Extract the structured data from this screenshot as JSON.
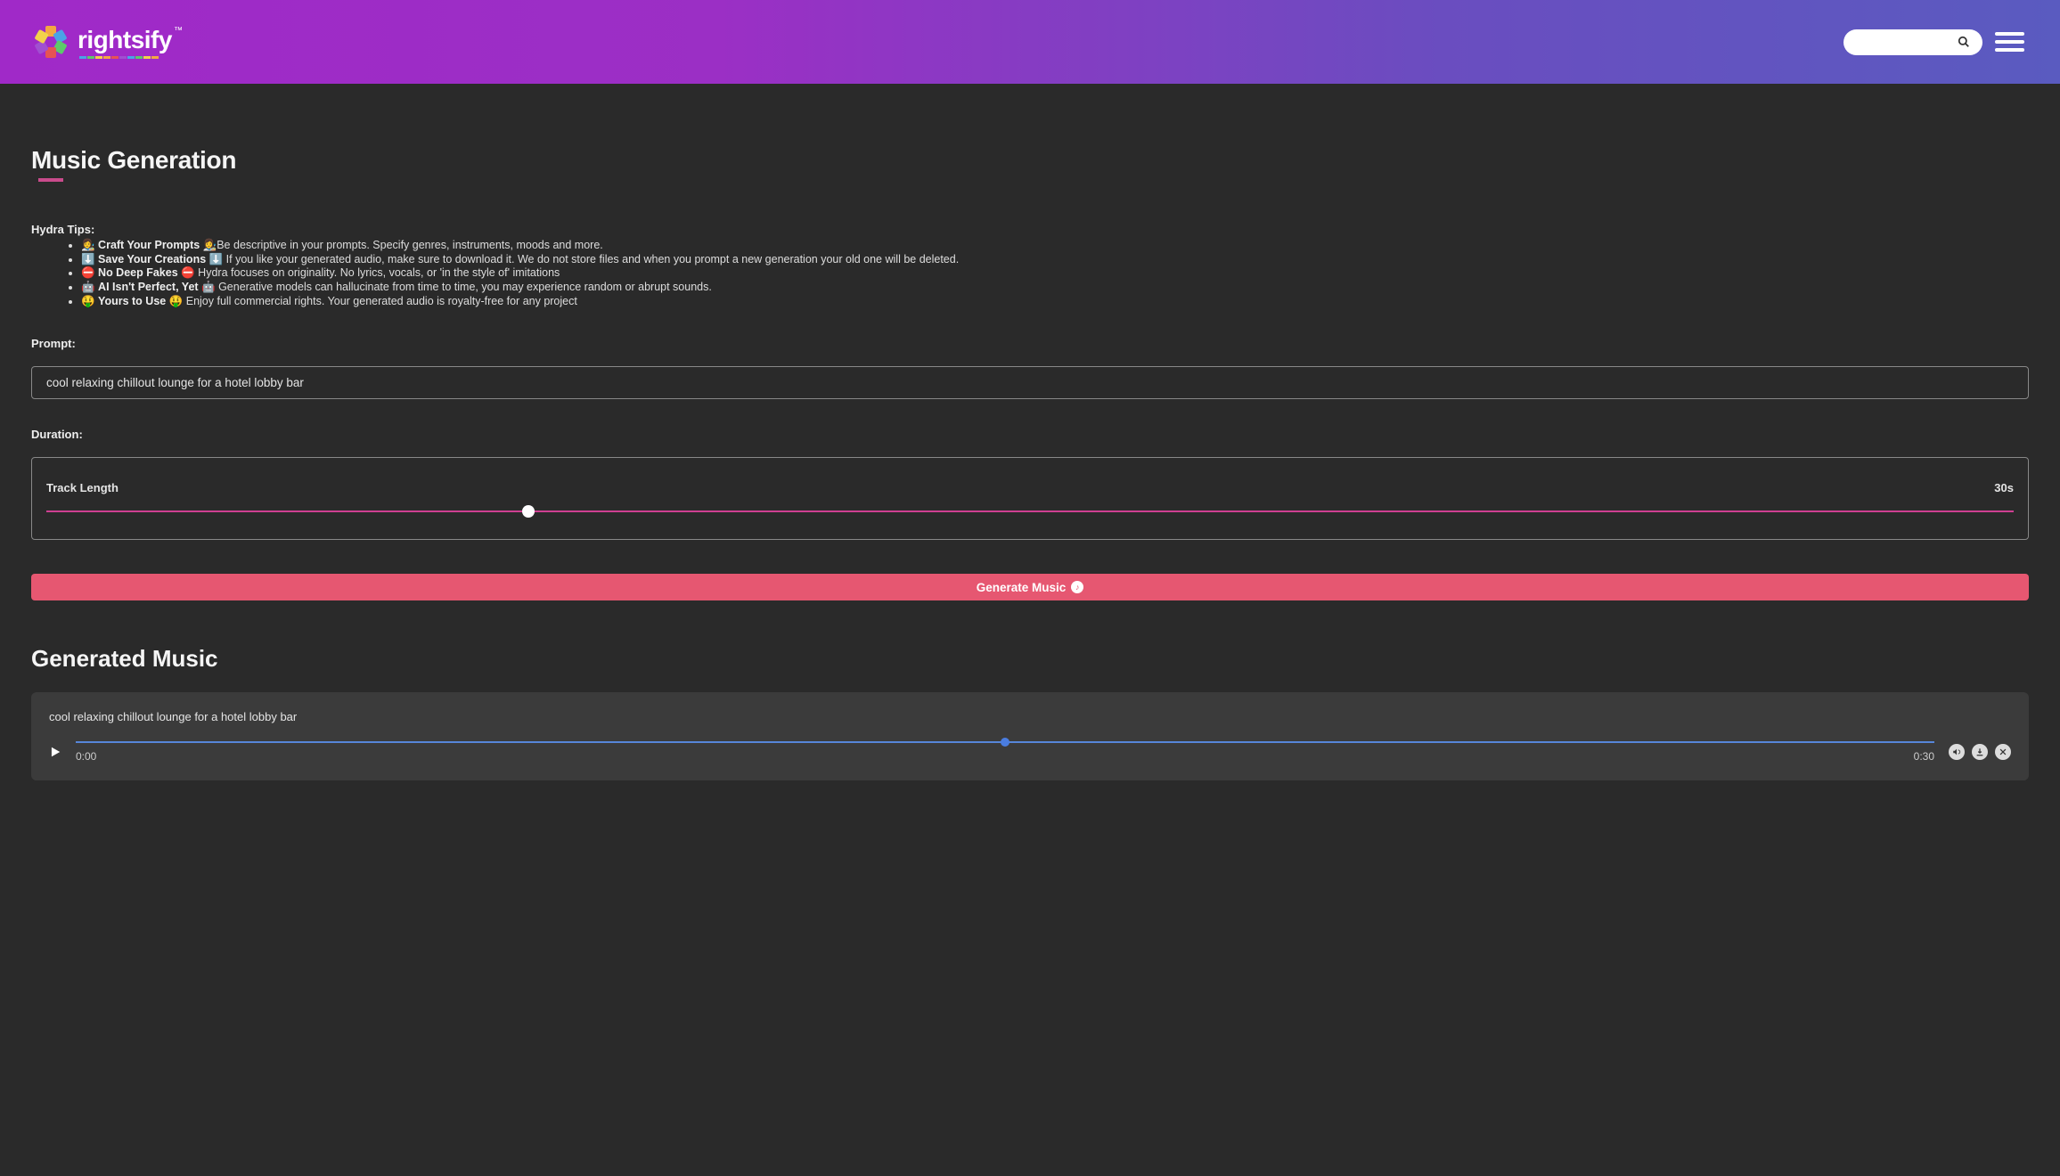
{
  "header": {
    "brand": "rightsify",
    "tm": "™"
  },
  "page": {
    "title": "Music Generation"
  },
  "tips": {
    "heading": "Hydra Tips:",
    "items": [
      {
        "prefix": "👩‍🎨 ",
        "bold": "Craft Your Prompts",
        "rest": " 👩‍🎨Be descriptive in your prompts. Specify genres, instruments, moods and more."
      },
      {
        "prefix": "⬇️ ",
        "bold": "Save Your Creations",
        "rest": " ⬇️ If you like your generated audio, make sure to download it. We do not store files and when you prompt a new generation your old one will be deleted."
      },
      {
        "prefix": "⛔ ",
        "bold": "No Deep Fakes",
        "rest": " ⛔ Hydra focuses on originality. No lyrics, vocals, or 'in the style of' imitations"
      },
      {
        "prefix": "🤖 ",
        "bold": "AI Isn't Perfect, Yet",
        "rest": " 🤖 Generative models can hallucinate from time to time, you may experience random or abrupt sounds."
      },
      {
        "prefix": "🤑 ",
        "bold": "Yours to Use",
        "rest": " 🤑 Enjoy full commercial rights. Your generated audio is royalty-free for any project"
      }
    ]
  },
  "prompt": {
    "label": "Prompt:",
    "value": "cool relaxing chillout lounge for a hotel lobby bar"
  },
  "duration": {
    "label": "Duration:",
    "track_length_label": "Track Length",
    "value_display": "30s"
  },
  "generate": {
    "label": "Generate Music"
  },
  "generated": {
    "heading": "Generated Music",
    "track_title": "cool relaxing chillout lounge for a hotel lobby bar",
    "time_start": "0:00",
    "time_end": "0:30"
  }
}
